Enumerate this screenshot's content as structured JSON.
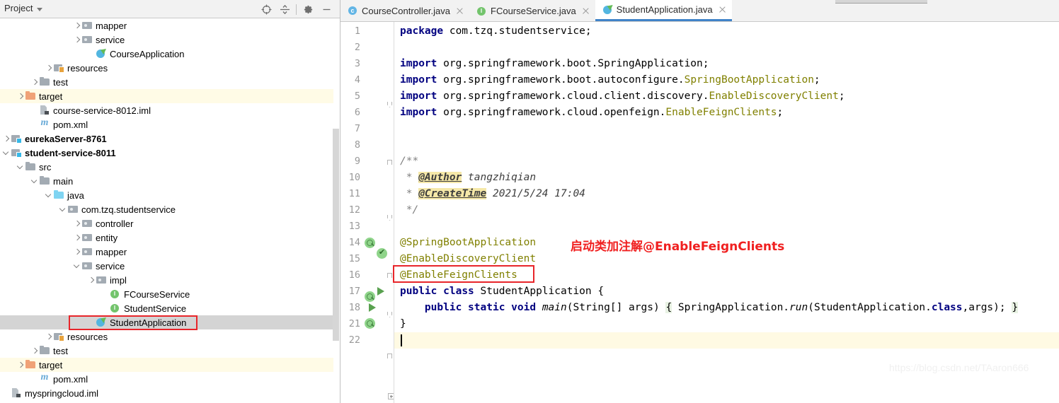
{
  "panel": {
    "title": "Project",
    "dropdown_icon": "chevron-down-icon",
    "toolbar_icons": [
      {
        "name": "locate-icon",
        "title": "Select Opened File"
      },
      {
        "name": "collapse-all-icon",
        "title": "Collapse All"
      },
      {
        "name": "gear-icon",
        "title": "Settings"
      },
      {
        "name": "minimize-icon",
        "title": "Hide"
      }
    ]
  },
  "tree": {
    "rows": [
      {
        "label": "mapper",
        "indent": 5,
        "arrow": "right",
        "icon": "folder-package-icon",
        "bold": false,
        "state": "none"
      },
      {
        "label": "service",
        "indent": 5,
        "arrow": "right",
        "icon": "folder-package-icon",
        "bold": false,
        "state": "none"
      },
      {
        "label": "CourseApplication",
        "indent": 6,
        "arrow": "none",
        "icon": "spring-boot-class-icon",
        "bold": false,
        "state": "none"
      },
      {
        "label": "resources",
        "indent": 3,
        "arrow": "right",
        "icon": "folder-resources-icon",
        "bold": false,
        "state": "none"
      },
      {
        "label": "test",
        "indent": 2,
        "arrow": "right",
        "icon": "folder-gray-icon",
        "bold": false,
        "state": "none"
      },
      {
        "label": "target",
        "indent": 1,
        "arrow": "right",
        "icon": "folder-orange-icon",
        "bold": false,
        "state": "target"
      },
      {
        "label": "course-service-8012.iml",
        "indent": 2,
        "arrow": "none",
        "icon": "iml-file-icon",
        "bold": false,
        "state": "none"
      },
      {
        "label": "pom.xml",
        "indent": 2,
        "arrow": "none",
        "icon": "maven-pom-icon",
        "bold": false,
        "state": "none"
      },
      {
        "label": "eurekaServer-8761",
        "indent": 0,
        "arrow": "right",
        "icon": "module-icon",
        "bold": true,
        "state": "none"
      },
      {
        "label": "student-service-8011",
        "indent": 0,
        "arrow": "down",
        "icon": "module-icon",
        "bold": true,
        "state": "none"
      },
      {
        "label": "src",
        "indent": 1,
        "arrow": "down",
        "icon": "folder-gray-icon",
        "bold": false,
        "state": "none"
      },
      {
        "label": "main",
        "indent": 2,
        "arrow": "down",
        "icon": "folder-gray-icon",
        "bold": false,
        "state": "none"
      },
      {
        "label": "java",
        "indent": 3,
        "arrow": "down",
        "icon": "folder-source-icon",
        "bold": false,
        "state": "none"
      },
      {
        "label": "com.tzq.studentservice",
        "indent": 4,
        "arrow": "down",
        "icon": "folder-package-icon",
        "bold": false,
        "state": "none"
      },
      {
        "label": "controller",
        "indent": 5,
        "arrow": "right",
        "icon": "folder-package-icon",
        "bold": false,
        "state": "none"
      },
      {
        "label": "entity",
        "indent": 5,
        "arrow": "right",
        "icon": "folder-package-icon",
        "bold": false,
        "state": "none"
      },
      {
        "label": "mapper",
        "indent": 5,
        "arrow": "right",
        "icon": "folder-package-icon",
        "bold": false,
        "state": "none"
      },
      {
        "label": "service",
        "indent": 5,
        "arrow": "down",
        "icon": "folder-package-icon",
        "bold": false,
        "state": "none"
      },
      {
        "label": "impl",
        "indent": 6,
        "arrow": "right",
        "icon": "folder-package-icon",
        "bold": false,
        "state": "none"
      },
      {
        "label": "FCourseService",
        "indent": 7,
        "arrow": "none",
        "icon": "interface-icon",
        "bold": false,
        "state": "none"
      },
      {
        "label": "StudentService",
        "indent": 7,
        "arrow": "none",
        "icon": "interface-icon",
        "bold": false,
        "state": "none"
      },
      {
        "label": "StudentApplication",
        "indent": 6,
        "arrow": "none",
        "icon": "spring-boot-class-icon",
        "bold": false,
        "state": "selected"
      },
      {
        "label": "resources",
        "indent": 3,
        "arrow": "right",
        "icon": "folder-resources-icon",
        "bold": false,
        "state": "none"
      },
      {
        "label": "test",
        "indent": 2,
        "arrow": "right",
        "icon": "folder-gray-icon",
        "bold": false,
        "state": "none"
      },
      {
        "label": "target",
        "indent": 1,
        "arrow": "right",
        "icon": "folder-orange-icon",
        "bold": false,
        "state": "target"
      },
      {
        "label": "pom.xml",
        "indent": 2,
        "arrow": "none",
        "icon": "maven-pom-icon",
        "bold": false,
        "state": "none"
      },
      {
        "label": "myspringcloud.iml",
        "indent": 0,
        "arrow": "none",
        "icon": "iml-file-icon",
        "bold": false,
        "state": "none"
      }
    ]
  },
  "tabs": [
    {
      "label": "CourseController.java",
      "icon": "java-class-icon",
      "active": false,
      "icon_color": "#62b5e5"
    },
    {
      "label": "FCourseService.java",
      "icon": "java-interface-icon",
      "active": false,
      "icon_color": "#73c46c"
    },
    {
      "label": "StudentApplication.java",
      "icon": "spring-boot-class-icon",
      "active": true,
      "icon_color": "#53b6e0"
    }
  ],
  "editor": {
    "lines": [
      {
        "num": "1",
        "current": false
      },
      {
        "num": "2",
        "current": false
      },
      {
        "num": "3",
        "current": false
      },
      {
        "num": "4",
        "current": false
      },
      {
        "num": "5",
        "current": false
      },
      {
        "num": "6",
        "current": false
      },
      {
        "num": "7",
        "current": false
      },
      {
        "num": "8",
        "current": false
      },
      {
        "num": "9",
        "current": false
      },
      {
        "num": "10",
        "current": false
      },
      {
        "num": "11",
        "current": false
      },
      {
        "num": "12",
        "current": false
      },
      {
        "num": "13",
        "current": false
      },
      {
        "num": "14",
        "current": false
      },
      {
        "num": "15",
        "current": false
      },
      {
        "num": "16",
        "current": false
      },
      {
        "num": "17",
        "current": false
      },
      {
        "num": "18",
        "current": false
      },
      {
        "num": "21",
        "current": false
      },
      {
        "num": "22",
        "current": true
      }
    ],
    "code": {
      "l1_kw": "package",
      "l1_rest": " com.tzq.studentservice;",
      "l3_kw": "import",
      "l3_rest": " org.springframework.boot.SpringApplication;",
      "l4_kw": "import",
      "l4_pkg": " org.springframework.boot.autoconfigure.",
      "l4_cls": "SpringBootApplication",
      "l4_end": ";",
      "l5_kw": "import",
      "l5_pkg": " org.springframework.cloud.client.discovery.",
      "l5_cls": "EnableDiscoveryClient",
      "l5_end": ";",
      "l6_kw": "import",
      "l6_pkg": " org.springframework.cloud.openfeign.",
      "l6_cls": "EnableFeignClients",
      "l6_end": ";",
      "l9": "/**",
      "l10_star": " * ",
      "l10_tag": "@Author",
      "l10_val": " tangzhiqian",
      "l11_star": " * ",
      "l11_tag": "@CreateTime",
      "l11_val": " 2021/5/24 17:04",
      "l12": " */",
      "l14": "@SpringBootApplication",
      "l15": "@EnableDiscoveryClient",
      "l16": "@EnableFeignClients",
      "l17_kw1": "public",
      "l17_kw2": "class",
      "l17_name": " StudentApplication {",
      "l18_kw1": "public",
      "l18_kw2": "static",
      "l18_kw3": "void",
      "l18_mth": " main",
      "l18_args": "(String[] args) ",
      "l18_brace_open": "{",
      "l18_body": " SpringApplication.",
      "l18_run": "run",
      "l18_body2": "(StudentApplication.",
      "l18_classkw": "class",
      "l18_body3": ",args); ",
      "l18_brace_close": "}",
      "l21": "}"
    }
  },
  "annotation": {
    "text": "启动类加注解@EnableFeignClients",
    "color": "#f02020"
  },
  "watermark": {
    "text": "https://blog.csdn.net/TAaron666"
  },
  "highlight_boxes": {
    "tree_selection_color": "#e8252a",
    "code_annotation_color": "#e8252a"
  }
}
